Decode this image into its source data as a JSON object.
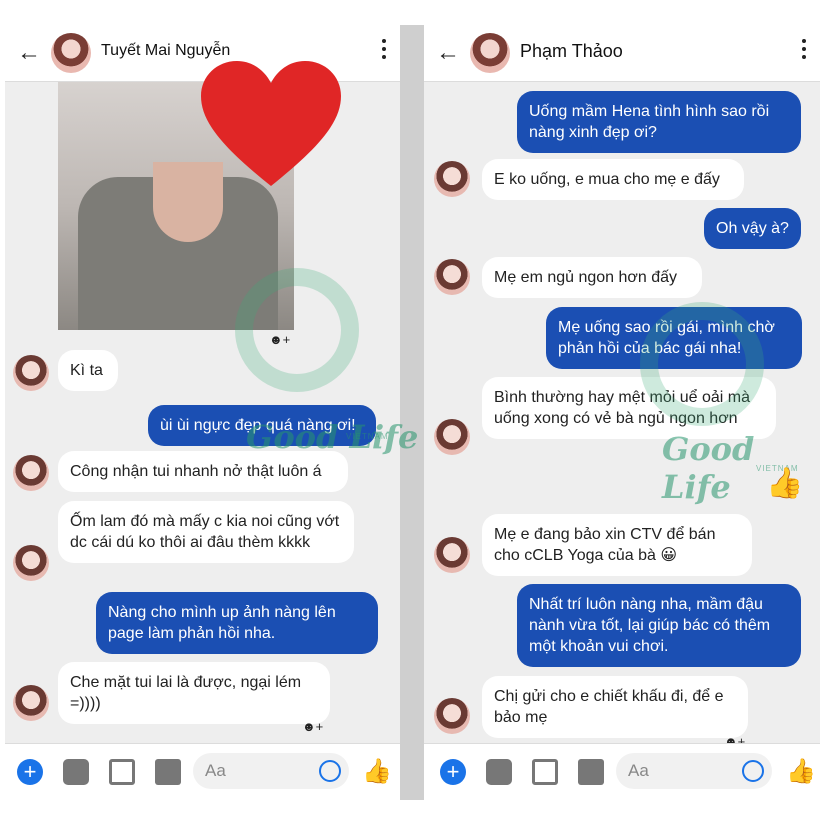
{
  "left": {
    "contact_name": "Tuyết Mai Nguyễn",
    "messages": [
      {
        "from": "them",
        "text": "Kì ta"
      },
      {
        "from": "me",
        "text": "ùi ùi ngực đẹp quá nàng ơi!"
      },
      {
        "from": "them",
        "text": "Công nhận tui nhanh nở thật luôn á"
      },
      {
        "from": "them",
        "text": "Ốm lam đó mà mấy c kia noi cũng vớt dc cái dú ko thôi ai đâu thèm kkkk"
      },
      {
        "from": "me",
        "text": "Nàng cho mình up ảnh nàng lên page làm phản hồi nha."
      },
      {
        "from": "them",
        "text": "Che mặt tui lai là được, ngại lém =))))"
      }
    ],
    "composer_placeholder": "Aa"
  },
  "right": {
    "contact_name": "Phạm Thảoo",
    "messages": [
      {
        "from": "me",
        "text": "Uống mầm Hena tình hình sao rồi nàng xinh đẹp ơi?"
      },
      {
        "from": "them",
        "text": "E ko uống, e mua cho mẹ e đấy"
      },
      {
        "from": "me",
        "text": "Oh vậy à?"
      },
      {
        "from": "them",
        "text": "Mẹ em ngủ ngon hơn đấy"
      },
      {
        "from": "me",
        "text": "Mẹ uống sao rồi gái, mình chờ phản hồi của bác gái nha!"
      },
      {
        "from": "them",
        "text": "Bình thường hay mệt mỏi uể oải mà uống xong có vẻ bà ngủ ngon hơn"
      },
      {
        "from": "them",
        "text": "Mẹ e đang bảo xin CTV để bán cho cCLB Yoga của bà 😀"
      },
      {
        "from": "me",
        "text": "Nhất trí luôn nàng nha, mầm đậu nành vừa tốt, lại giúp bác có thêm một khoản vui chơi."
      },
      {
        "from": "them",
        "text": "Chị gửi cho e chiết khấu đi, để e bảo mẹ"
      }
    ],
    "composer_placeholder": "Aa"
  },
  "watermark": {
    "text": "Good Life",
    "sub": "VIETNAM"
  },
  "colors": {
    "outgoing_bubble": "#1b4fb3",
    "incoming_bubble": "#ffffff",
    "accent": "#1a73e8"
  }
}
